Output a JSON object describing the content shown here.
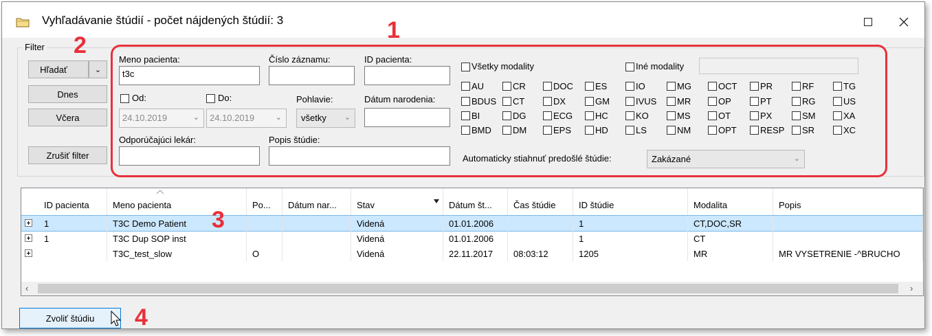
{
  "window": {
    "title": "Vyhľadávanie štúdií - počet nájdených štúdií: 3"
  },
  "filter": {
    "group_label": "Filter",
    "search_button": "Hľadať",
    "today_button": "Dnes",
    "yesterday_button": "Včera",
    "clear_button": "Zrušiť filter",
    "patient_name_label": "Meno pacienta:",
    "patient_name_value": "t3c",
    "record_number_label": "Číslo záznamu:",
    "record_number_value": "",
    "patient_id_label": "ID pacienta:",
    "patient_id_value": "",
    "from_label": "Od:",
    "from_value": "24.10.2019",
    "to_label": "Do:",
    "to_value": "24.10.2019",
    "gender_label": "Pohlavie:",
    "gender_value": "všetky",
    "birth_date_label": "Dátum narodenia:",
    "birth_date_value": "",
    "referring_label": "Odporúčajúci lekár:",
    "referring_value": "",
    "study_desc_label": "Popis štúdie:",
    "study_desc_value": "",
    "all_modalities_label": "Všetky modality",
    "other_modalities_label": "Iné modality",
    "other_modalities_value": "",
    "modalities": [
      [
        "AU",
        "CR",
        "DOC",
        "ES",
        "IO",
        "MG",
        "OCT",
        "PR",
        "RF",
        "TG"
      ],
      [
        "BDUS",
        "CT",
        "DX",
        "GM",
        "IVUS",
        "MR",
        "OP",
        "PT",
        "RG",
        "US"
      ],
      [
        "BI",
        "DG",
        "ECG",
        "HC",
        "KO",
        "MS",
        "OT",
        "PX",
        "SM",
        "XA"
      ],
      [
        "BMD",
        "DM",
        "EPS",
        "HD",
        "LS",
        "NM",
        "OPT",
        "RESP",
        "SR",
        "XC"
      ]
    ],
    "auto_download_label": "Automaticky stiahnuť predošlé štúdie:",
    "auto_download_value": "Zakázané"
  },
  "grid": {
    "columns": [
      "ID pacienta",
      "Meno pacienta",
      "Po...",
      "Dátum nar...",
      "Stav",
      "Dátum št...",
      "Čas štúdie",
      "ID štúdie",
      "Modalita",
      "Popis"
    ],
    "rows": [
      [
        "1",
        "T3C Demo Patient",
        "",
        "",
        "Videná",
        "01.01.2006",
        "",
        "1",
        "CT,DOC,SR",
        ""
      ],
      [
        "1",
        "T3C Dup SOP inst",
        "",
        "",
        "Videná",
        "01.01.2006",
        "",
        "1",
        "CT",
        ""
      ],
      [
        "",
        "T3C_test_slow",
        "O",
        "",
        "Videná",
        "22.11.2017",
        "08:03:12",
        "1205",
        "MR",
        "MR VYSETRENIE -^BRUCHO"
      ]
    ]
  },
  "select_button": "Zvoliť štúdiu",
  "callouts": [
    "1",
    "2",
    "3",
    "4"
  ],
  "colors": {
    "callout_red": "#e8303a",
    "selected_row": "#cce8ff"
  },
  "icons": [
    "folder-icon",
    "maximize-icon",
    "close-icon",
    "dropdown-arrow-icon",
    "sort-ascending-icon",
    "filter-arrow-icon",
    "expand-icon",
    "scroll-left-icon",
    "scroll-right-icon",
    "cursor-icon"
  ]
}
